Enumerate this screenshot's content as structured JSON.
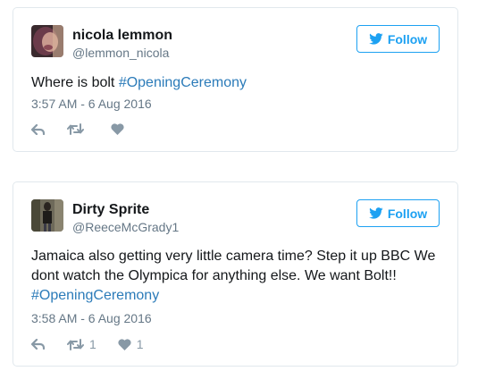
{
  "tweets": [
    {
      "display_name": "nicola lemmon",
      "handle": "@lemmon_nicola",
      "text_before": "Where is bolt ",
      "hashtag": "#OpeningCeremony",
      "text_after": "",
      "timestamp": "3:57 AM - 6 Aug 2016",
      "follow_label": "Follow",
      "retweet_count": "",
      "like_count": ""
    },
    {
      "display_name": "Dirty Sprite",
      "handle": "@ReeceMcGrady1",
      "text_before": "Jamaica also getting very little camera time? Step it up BBC We dont watch the Olympica for anything else. We want Bolt!! ",
      "hashtag": "#OpeningCeremony",
      "text_after": "",
      "timestamp": "3:58 AM - 6 Aug 2016",
      "follow_label": "Follow",
      "retweet_count": "1",
      "like_count": "1"
    }
  ],
  "icons": {
    "follow": "twitter-bird-icon",
    "reply": "reply-icon",
    "retweet": "retweet-icon",
    "like": "heart-icon"
  },
  "colors": {
    "accent": "#1da1f2",
    "hashtag": "#2b7bb9",
    "muted": "#657786",
    "action": "#8899a6"
  }
}
